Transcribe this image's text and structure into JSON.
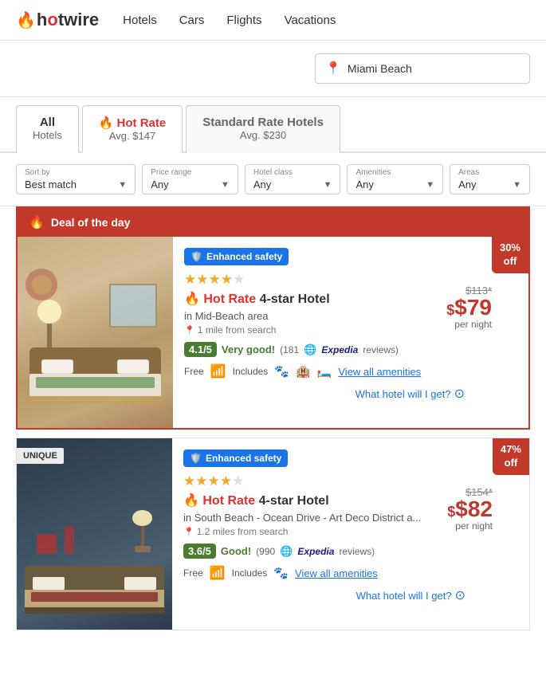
{
  "header": {
    "logo": "hotwire",
    "logo_fire": "🔥",
    "nav": {
      "hotels": "Hotels",
      "cars": "Cars",
      "flights": "Flights",
      "vacations": "Vacations"
    }
  },
  "search": {
    "location": "Miami Beach",
    "placeholder": "Miami Beach"
  },
  "tabs": [
    {
      "id": "all",
      "title": "All",
      "subtitle": "Hotels",
      "active": false
    },
    {
      "id": "hot",
      "title": "Hot Rate",
      "subtitle": "Avg. $147",
      "active": true,
      "hot": true
    },
    {
      "id": "standard",
      "title": "Standard Rate Hotels",
      "subtitle": "Avg. $230",
      "active": false
    }
  ],
  "filters": {
    "sort": {
      "label": "Sort by",
      "value": "Best match"
    },
    "price": {
      "label": "Price range",
      "value": "Any"
    },
    "class": {
      "label": "Hotel class",
      "value": "Any"
    },
    "amenities": {
      "label": "Amenities",
      "value": "Any"
    },
    "areas": {
      "label": "Areas",
      "value": "Any"
    }
  },
  "deal_banner": {
    "icon": "🔥",
    "text": "Deal of the day"
  },
  "hotels": [
    {
      "id": 1,
      "deal_of_day": true,
      "discount": "30%",
      "discount_label": "off",
      "safety_badge": "Enhanced safety",
      "stars": 4,
      "name_label": "Hot Rate",
      "name_type": "4-star Hotel",
      "location": "in Mid-Beach area",
      "distance": "1 mile from search",
      "rating": "4.1/5",
      "rating_desc": "Very good!",
      "reviews": "(181",
      "reviews_platform": "Expedia",
      "reviews_suffix": "reviews)",
      "price_original": "$113*",
      "price_current": "$79",
      "price_per_night": "per night",
      "amenities_free": "Free",
      "amenities_includes": "Includes",
      "view_amenities": "View all amenities",
      "what_hotel": "What hotel will I get?",
      "unique": false
    },
    {
      "id": 2,
      "deal_of_day": false,
      "discount": "47%",
      "discount_label": "off",
      "safety_badge": "Enhanced safety",
      "stars": 4,
      "name_label": "Hot Rate",
      "name_type": "4-star Hotel",
      "location": "in South Beach - Ocean Drive - Art Deco District a...",
      "distance": "1.2 miles from search",
      "rating": "3.6/5",
      "rating_desc": "Good!",
      "reviews": "(990",
      "reviews_platform": "Expedia",
      "reviews_suffix": "reviews)",
      "price_original": "$154*",
      "price_current": "$82",
      "price_per_night": "per night",
      "amenities_free": "Free",
      "amenities_includes": "Includes",
      "view_amenities": "View all amenities",
      "what_hotel": "What hotel will I get?",
      "unique": true,
      "unique_label": "UNIQUE"
    }
  ],
  "colors": {
    "red": "#c0392b",
    "blue": "#1a73e8",
    "green": "#4a7c2f",
    "star_color": "#f5a623"
  }
}
